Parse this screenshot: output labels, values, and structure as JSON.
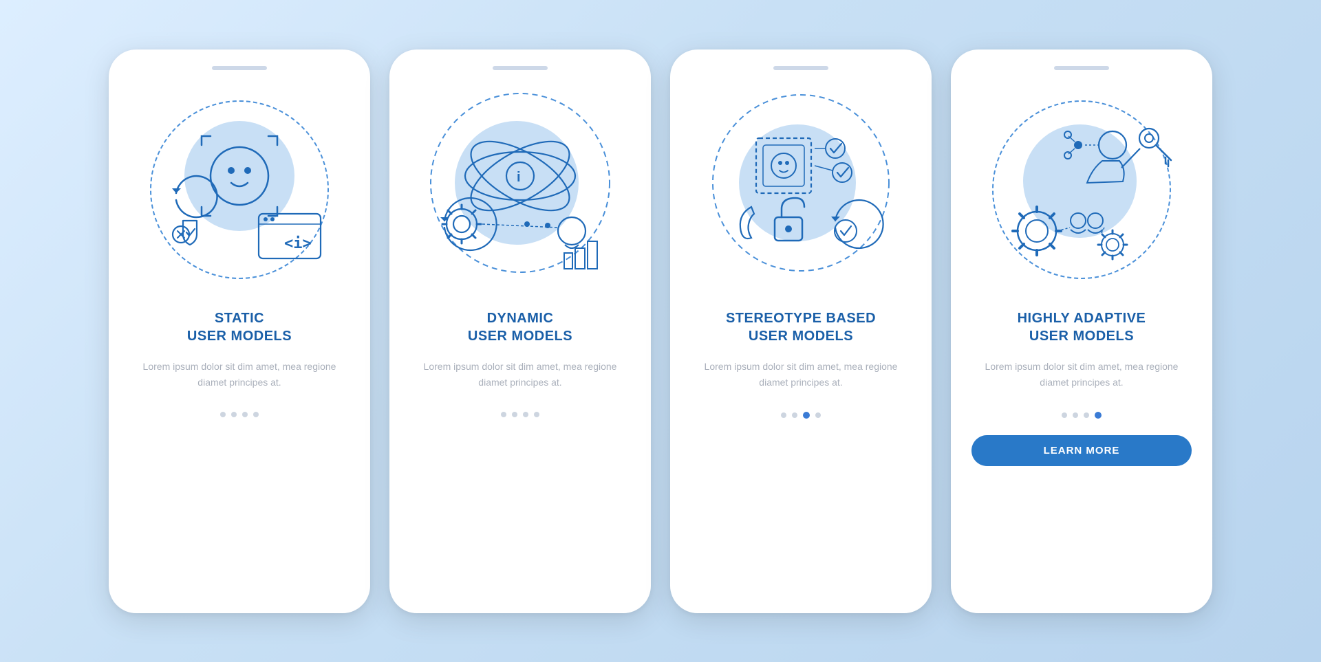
{
  "cards": [
    {
      "id": "static",
      "title": "STATIC\nUSER MODELS",
      "description": "Lorem ipsum dolor sit dim amet, mea regione diamet principes at.",
      "dots": [
        false,
        false,
        false,
        false
      ],
      "activeDot": -1,
      "hasButton": false,
      "buttonLabel": ""
    },
    {
      "id": "dynamic",
      "title": "DYNAMIC\nUSER MODELS",
      "description": "Lorem ipsum dolor sit dim amet, mea regione diamet principes at.",
      "dots": [
        false,
        false,
        false,
        false
      ],
      "activeDot": -1,
      "hasButton": false,
      "buttonLabel": ""
    },
    {
      "id": "stereotype",
      "title": "STEREOTYPE BASED\nUSER MODELS",
      "description": "Lorem ipsum dolor sit dim amet, mea regione diamet principes at.",
      "dots": [
        false,
        false,
        false,
        false
      ],
      "activeDot": 2,
      "hasButton": false,
      "buttonLabel": ""
    },
    {
      "id": "highly-adaptive",
      "title": "HIGHLY ADAPTIVE\nUSER MODELS",
      "description": "Lorem ipsum dolor sit dim amet, mea regione diamet principes at.",
      "dots": [
        false,
        false,
        false,
        false
      ],
      "activeDot": 3,
      "hasButton": true,
      "buttonLabel": "LEARN MORE"
    }
  ],
  "colors": {
    "primary": "#1a5fa8",
    "accent": "#2979c8",
    "lightBlue": "#c8dff5",
    "dashedCircle": "#4a90d9",
    "iconStroke": "#1f6ab8",
    "dotInactive": "#cdd5e0",
    "dotActive": "#3a7bd5",
    "descriptionText": "#aab0bb"
  }
}
